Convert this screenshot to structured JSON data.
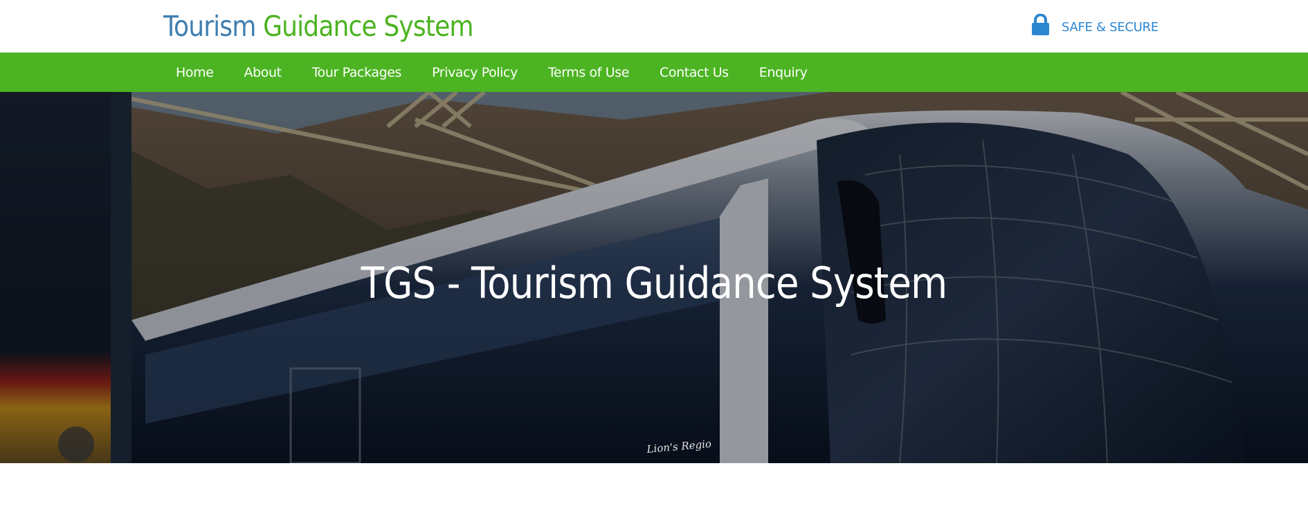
{
  "header": {
    "logo_part1": "Tourism ",
    "logo_part2": "Guidance System",
    "secure_icon": "lock-icon",
    "secure_label": "SAFE & SECURE"
  },
  "nav": {
    "items": [
      {
        "label": "Home"
      },
      {
        "label": "About"
      },
      {
        "label": "Tour Packages"
      },
      {
        "label": "Privacy Policy"
      },
      {
        "label": "Terms of Use"
      },
      {
        "label": "Contact Us"
      },
      {
        "label": "Enquiry"
      }
    ]
  },
  "hero": {
    "title": "TGS - Tourism Guidance System",
    "bus_lettering": "Lion's Regio"
  },
  "colors": {
    "logo_blue": "#3f7fb0",
    "brand_green": "#4cb422",
    "secure_blue": "#2c86d0"
  }
}
